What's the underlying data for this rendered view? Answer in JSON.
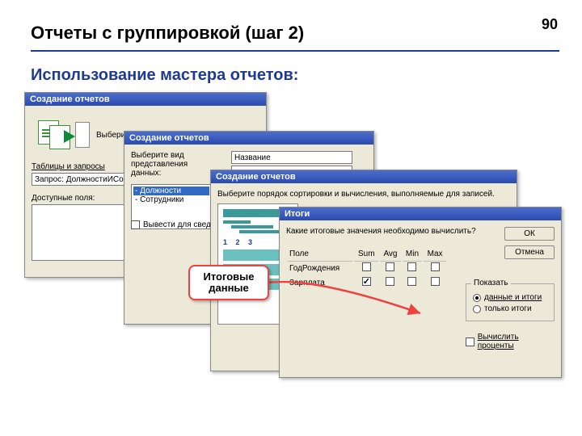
{
  "page_number": "90",
  "slide_title": "Отчеты с группировкой (шаг 2)",
  "subtitle": "Использование мастера отчетов:",
  "callout": "Итоговые данные",
  "dlg1": {
    "title": "Создание отчетов",
    "prompt": "Выберите поля для отчета.",
    "tables_label": "Таблицы и запросы",
    "query": "Запрос: ДолжностиИСо",
    "avail_label": "Доступные поля:"
  },
  "dlg2": {
    "title": "Создание отчетов",
    "prompt": "Выберите вид представления данных:",
    "items": [
      "- Должности",
      "- Сотрудники"
    ],
    "preview_field": "Название",
    "checkbox_label": "Вывести для сведения"
  },
  "dlg3": {
    "title": "Создание отчетов",
    "prompt": "Выберите порядок сортировки и вычисления, выполняемые для записей.",
    "nums": "1  2  3"
  },
  "dlg4": {
    "title": "Итоги",
    "prompt": "Какие итоговые значения необходимо вычислить?",
    "ok": "ОК",
    "cancel": "Отмена",
    "headers": {
      "field": "Поле",
      "sum": "Sum",
      "avg": "Avg",
      "min": "Min",
      "max": "Max"
    },
    "rows": [
      {
        "name": "ГодРождения",
        "sum": false,
        "avg": false,
        "min": false,
        "max": false
      },
      {
        "name": "Зарплата",
        "sum": true,
        "avg": false,
        "min": false,
        "max": false
      }
    ],
    "group_legend": "Показать",
    "radio_both": "данные и итоги",
    "radio_totals": "только итоги",
    "calc_pct": "Вычислить проценты"
  }
}
